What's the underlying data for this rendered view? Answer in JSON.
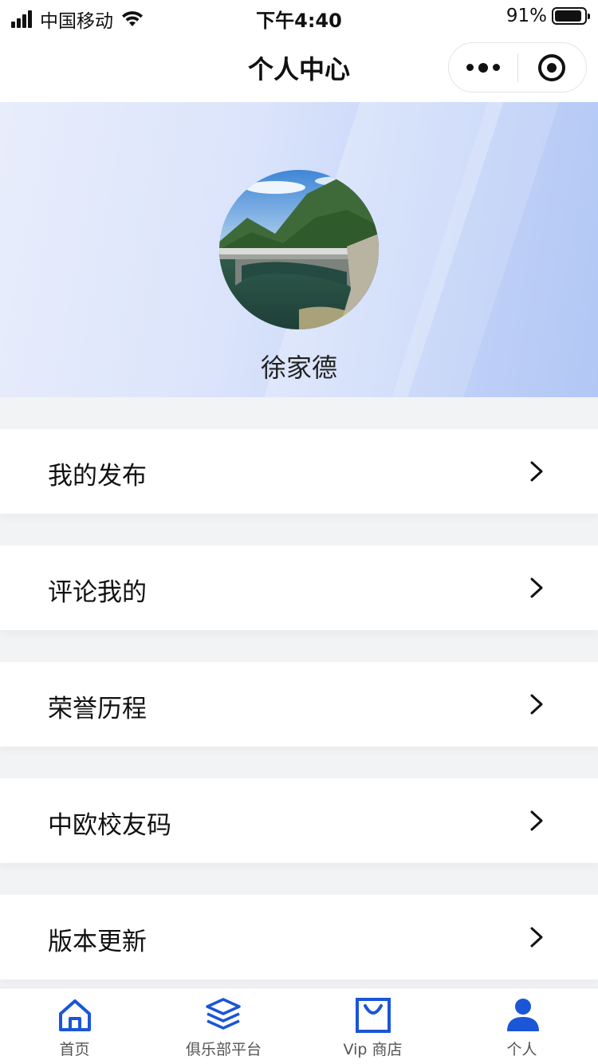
{
  "status_bar": {
    "carrier": "中国移动",
    "time": "下午4:40",
    "battery": "91%"
  },
  "nav": {
    "title": "个人中心"
  },
  "profile": {
    "name": "徐家德"
  },
  "menu": [
    {
      "label": "我的发布"
    },
    {
      "label": "评论我的"
    },
    {
      "label": "荣誉历程"
    },
    {
      "label": "中欧校友码"
    },
    {
      "label": "版本更新"
    }
  ],
  "tabs": [
    {
      "label": "首页",
      "icon": "home-icon"
    },
    {
      "label": "俱乐部平台",
      "icon": "layers-icon"
    },
    {
      "label": "Vip 商店",
      "icon": "shopping-bag-icon"
    },
    {
      "label": "个人",
      "icon": "person-icon",
      "active": true
    }
  ],
  "colors": {
    "accent": "#1a56d6",
    "header_gradient_start": "#e8edfb",
    "header_gradient_end": "#b2c7f5"
  }
}
